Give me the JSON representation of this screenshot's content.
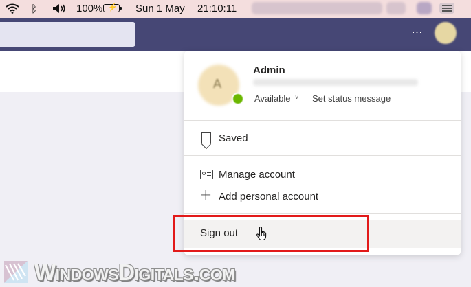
{
  "menubar": {
    "battery_percent": "100%",
    "date": "Sun 1 May",
    "time": "21:10:11",
    "icons": [
      "wifi-icon",
      "bluetooth-icon",
      "volume-icon",
      "battery-charging-icon",
      "control-center-icon"
    ]
  },
  "header": {
    "more_label": "⋯",
    "brand_color": "#464775"
  },
  "profile": {
    "avatar_initial": "A",
    "name": "Admin",
    "presence": "Available",
    "presence_chevron": "˅",
    "set_status_label": "Set status message",
    "presence_color": "#6bb700"
  },
  "menu": {
    "saved_label": "Saved",
    "manage_account_label": "Manage account",
    "add_personal_label": "Add personal account",
    "sign_out_label": "Sign out"
  },
  "highlight_color": "#e21a1a",
  "watermark": {
    "text": "WindowsDigitals.com"
  }
}
